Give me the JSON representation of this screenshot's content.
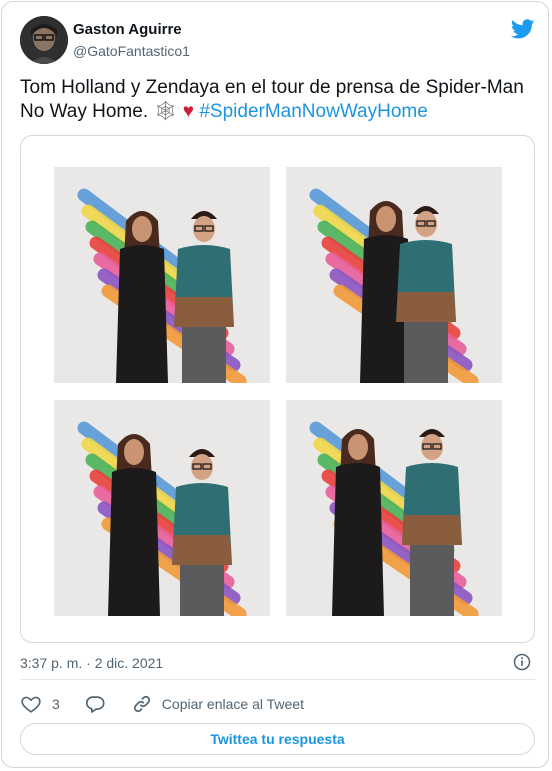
{
  "author": {
    "name": "Gaston Aguirre",
    "handle": "@GatoFantastico1"
  },
  "tweet": {
    "text_line1": "Tom Holland y Zendaya en el tour de prensa de Spider-Man",
    "text_line2": "No Way Home.",
    "emoji_web": "🕸",
    "emoji_heart": "♥",
    "hashtag": "#SpiderManNowWayHome",
    "timestamp": "3:37 p. m. · 2 dic. 2021"
  },
  "media": {
    "photo_count": 4,
    "stripe_colors": [
      "#f1d84a",
      "#4bb35a",
      "#5a9ad8",
      "#e8413c",
      "#e85f9a",
      "#8a55c2",
      "#f29a3a"
    ]
  },
  "actions": {
    "like_count": "3",
    "copy_link_label": "Copiar enlace al Tweet"
  },
  "reply_button": {
    "label": "Twittea tu respuesta"
  },
  "colors": {
    "accent": "#1b95e0",
    "heart": "#d01c36",
    "muted": "#536471"
  }
}
